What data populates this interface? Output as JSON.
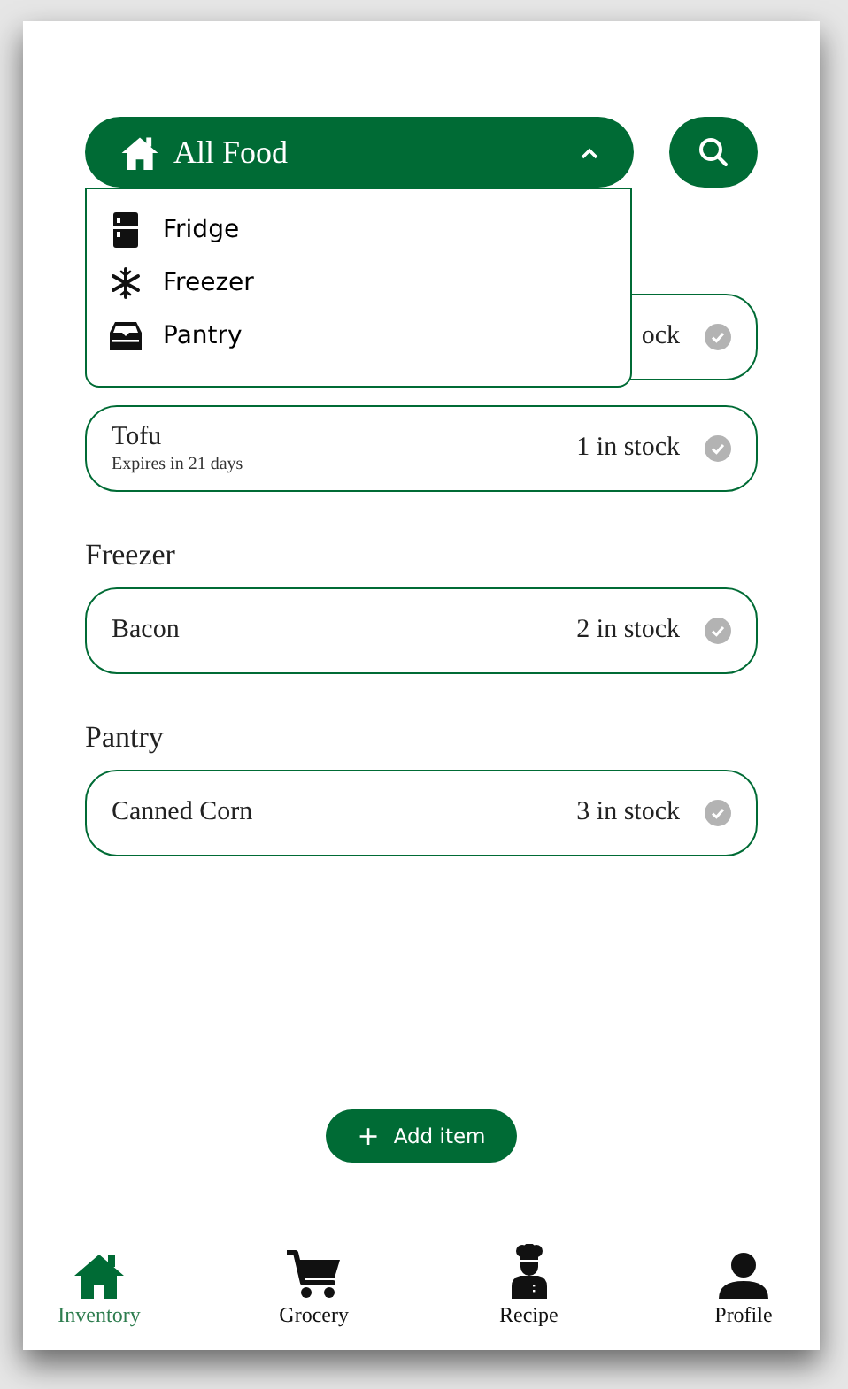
{
  "filter": {
    "label": "All Food",
    "expanded": true
  },
  "menu": [
    {
      "kind": "fridge",
      "label": "Fridge"
    },
    {
      "kind": "freezer",
      "label": "Freezer"
    },
    {
      "kind": "pantry",
      "label": "Pantry"
    }
  ],
  "sections": [
    {
      "items": [
        {
          "stock": "ock"
        },
        {
          "name": "Tofu",
          "note": "Expires in 21 days",
          "stock": "1 in stock"
        }
      ]
    },
    {
      "title": "Freezer",
      "items": [
        {
          "name": "Bacon",
          "stock": "2 in stock"
        }
      ]
    },
    {
      "title": "Pantry",
      "items": [
        {
          "name": "Canned Corn",
          "stock": "3 in stock"
        }
      ]
    }
  ],
  "add_button": {
    "icon": "+",
    "label": "Add item"
  },
  "nav": [
    {
      "kind": "home",
      "label": "Inventory",
      "selected": true
    },
    {
      "kind": "cart",
      "label": "Grocery",
      "selected": false
    },
    {
      "kind": "chef",
      "label": "Recipe",
      "selected": false
    },
    {
      "kind": "person",
      "label": "Profile",
      "selected": false
    }
  ]
}
